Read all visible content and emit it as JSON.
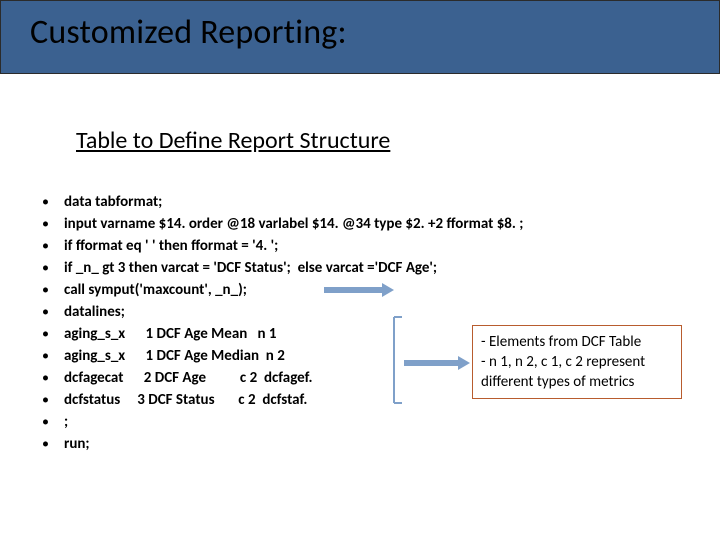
{
  "title": "Customized Reporting:",
  "subtitle": "Table to Define Report Structure",
  "code": {
    "l0": "data tabformat;",
    "l1": "input varname $14. order @18 varlabel $14. @34 type $2. +2 fformat $8. ;",
    "l2": "if fformat eq ' ' then fformat = '4. ';",
    "l3": "if _n_ gt 3 then varcat = 'DCF Status';  else varcat ='DCF Age';",
    "l4": "call symput('maxcount', _n_);",
    "l5": "datalines;",
    "l6": "aging_s_x      1 DCF Age Mean   n 1",
    "l7": "aging_s_x      1 DCF Age Median  n 2",
    "l8": "dcfagecat      2 DCF Age          c 2  dcfagef.",
    "l9": "dcfstatus     3 DCF Status       c 2  dcfstaf.",
    "l10": ";",
    "l11": "run;"
  },
  "annotation": {
    "line1": "- Elements from DCF Table",
    "line2": "- n 1, n 2, c 1, c 2 represent",
    "line3": "different types of metrics"
  },
  "colors": {
    "titleBar": "#3b6190",
    "arrow": "#7fa0c9",
    "boxBorder": "#b85c2e"
  }
}
